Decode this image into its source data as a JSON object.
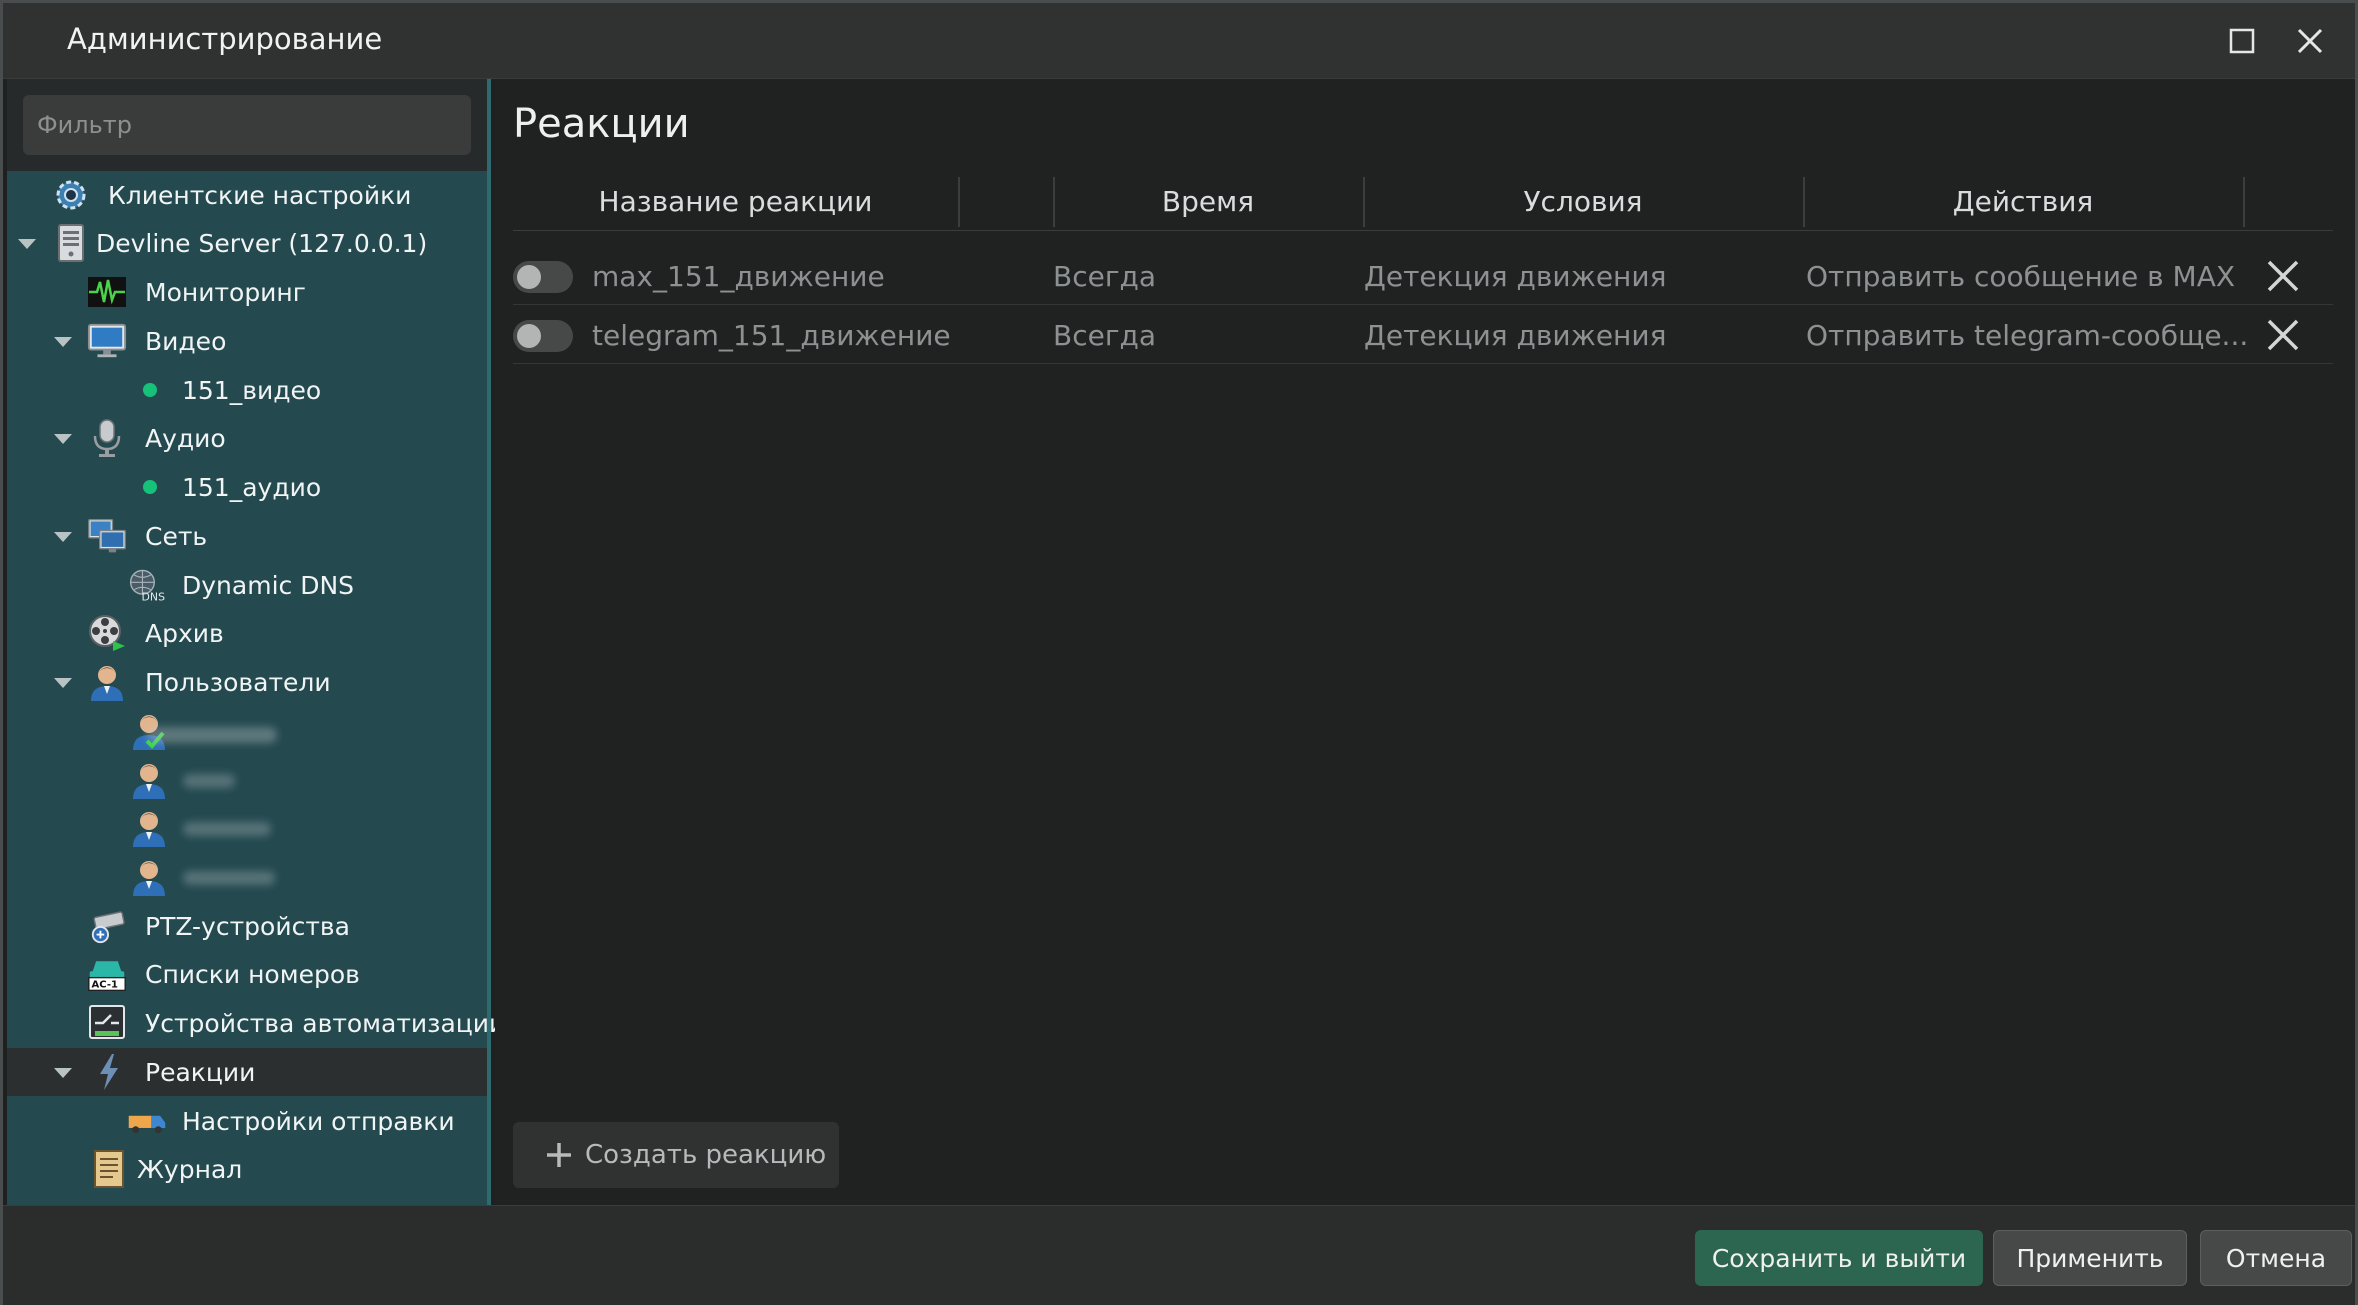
{
  "window": {
    "title": "Администрирование",
    "maximize_icon": "maximize-icon",
    "close_icon": "close-icon"
  },
  "sidebar": {
    "filter_placeholder": "Фильтр",
    "tree": {
      "client_settings": "Клиентские настройки",
      "server": "Devline Server (127.0.0.1)",
      "monitoring": "Мониторинг",
      "video": "Видео",
      "video_child": "151_видео",
      "audio": "Аудио",
      "audio_child": "151_аудио",
      "network": "Сеть",
      "dynamic_dns": "Dynamic DNS",
      "archive": "Архив",
      "users": "Пользователи",
      "ptz": "PTZ-устройства",
      "plate_lists": "Списки номеров",
      "automation": "Устройства автоматизации",
      "reactions": "Реакции",
      "send_settings": "Настройки отправки",
      "journal": "Журнал"
    }
  },
  "main": {
    "title": "Реакции",
    "columns": [
      "Название реакции",
      "Время",
      "Условия",
      "Действия"
    ],
    "rows": [
      {
        "name": "max_151_движение",
        "time": "Всегда",
        "condition": "Детекция движения",
        "action": "Отправить сообщение в MAX",
        "enabled": false
      },
      {
        "name": "telegram_151_движение",
        "time": "Всегда",
        "condition": "Детекция движения",
        "action": "Отправить telegram-сообще...",
        "enabled": false
      }
    ],
    "create_button": "Создать реакцию"
  },
  "footer": {
    "save_exit": "Сохранить и выйти",
    "apply": "Применить",
    "cancel": "Отмена"
  },
  "colors": {
    "tree_bg": "#244a50",
    "primary_button": "#2d6650",
    "status_dot": "#16c27a"
  }
}
